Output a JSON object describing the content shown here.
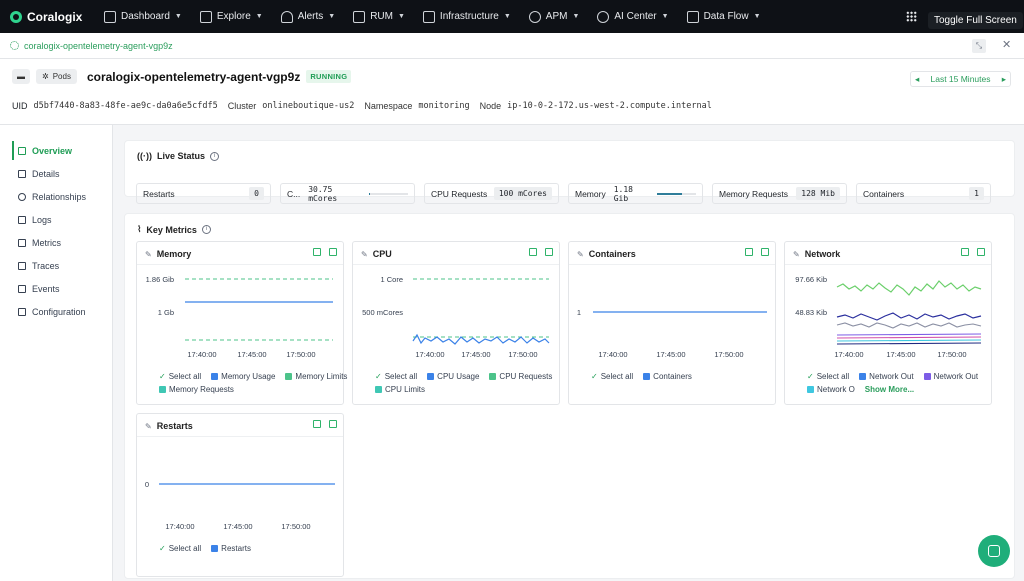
{
  "app": {
    "brand": "Coralogix"
  },
  "nav": [
    {
      "label": "Dashboard",
      "icon": "dashboard-icon"
    },
    {
      "label": "Explore",
      "icon": "explore-icon"
    },
    {
      "label": "Alerts",
      "icon": "bell-icon"
    },
    {
      "label": "RUM",
      "icon": "rum-icon"
    },
    {
      "label": "Infrastructure",
      "icon": "server-icon"
    },
    {
      "label": "APM",
      "icon": "gauge-icon"
    },
    {
      "label": "AI Center",
      "icon": "ai-icon"
    },
    {
      "label": "Data Flow",
      "icon": "dataflow-icon"
    }
  ],
  "tooltip": "Toggle Full Screen",
  "tab": {
    "label": "coralogix-opentelemetry-agent-vgp9z"
  },
  "header": {
    "kind": "Pods",
    "name": "coralogix-opentelemetry-agent-vgp9z",
    "status": "RUNNING",
    "time_range": "Last 15 Minutes",
    "meta": [
      {
        "label": "UID",
        "value": "d5bf7440-8a83-48fe-ae9c-da0a6e5cfdf5"
      },
      {
        "label": "Cluster",
        "value": "onlineboutique-us2"
      },
      {
        "label": "Namespace",
        "value": "monitoring"
      },
      {
        "label": "Node",
        "value": "ip-10-0-2-172.us-west-2.compute.internal"
      }
    ]
  },
  "sidebar": [
    {
      "label": "Overview",
      "active": true
    },
    {
      "label": "Details"
    },
    {
      "label": "Relationships"
    },
    {
      "label": "Logs"
    },
    {
      "label": "Metrics"
    },
    {
      "label": "Traces"
    },
    {
      "label": "Events"
    },
    {
      "label": "Configuration"
    }
  ],
  "live_status": {
    "title": "Live Status",
    "restarts": {
      "label": "Restarts",
      "value": "0"
    },
    "cpu": {
      "label": "C...",
      "value": "30.75 mCores",
      "fraction": 0.03
    },
    "cpu_requests": {
      "label": "CPU Requests",
      "value": "100 mCores"
    },
    "memory": {
      "label": "Memory",
      "value": "1.18 Gib",
      "fraction": 0.63
    },
    "memory_requests": {
      "label": "Memory Requests",
      "value": "128 Mib"
    },
    "containers": {
      "label": "Containers",
      "value": "1"
    }
  },
  "key_metrics": {
    "title": "Key Metrics",
    "colors": {
      "blue": "#3b82e8",
      "green": "#4cc38a",
      "teal": "#3fc7b4",
      "dashed_green": "#4cc38a"
    },
    "x_ticks": [
      "17:40:00",
      "17:45:00",
      "17:50:00"
    ],
    "memory": {
      "title": "Memory",
      "y_ticks": [
        "1.86 Gib",
        "1 Gb"
      ],
      "legend": [
        "Select all",
        "Memory Usage",
        "Memory Limits",
        "Memory Requests"
      ]
    },
    "cpu": {
      "title": "CPU",
      "y_ticks": [
        "1 Core",
        "500 mCores"
      ],
      "legend": [
        "Select all",
        "CPU Usage",
        "CPU Requests",
        "CPU Limits"
      ]
    },
    "containers": {
      "title": "Containers",
      "y_ticks": [
        "1"
      ],
      "legend": [
        "Select all",
        "Containers"
      ]
    },
    "network": {
      "title": "Network",
      "y_ticks": [
        "97.66 Kib",
        "48.83 Kib"
      ],
      "legend": [
        "Select all",
        "Network Out",
        "Network Out",
        "Network O"
      ],
      "show_more": "Show More..."
    },
    "restarts": {
      "title": "Restarts",
      "y_ticks": [
        "0"
      ],
      "legend": [
        "Select all",
        "Restarts"
      ]
    }
  }
}
